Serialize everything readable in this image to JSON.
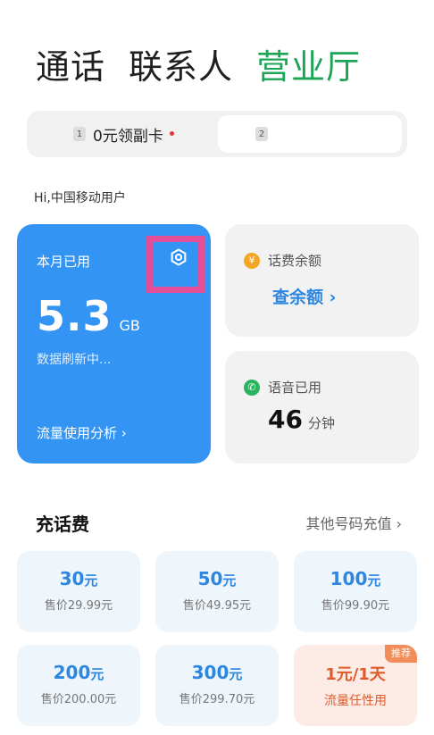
{
  "tabs": [
    "通话",
    "联系人",
    "营业厅"
  ],
  "sim": {
    "slot1_num": "1",
    "slot1_text": "0元领副卡",
    "slot2_num": "2"
  },
  "greeting": "Hi,中国移动用户",
  "data_card": {
    "label": "本月已用",
    "amount": "5.3",
    "unit": "GB",
    "status": "数据刷新中...",
    "analysis": "流量使用分析 ›"
  },
  "balance_card": {
    "icon_glyph": "¥",
    "title": "话费余额",
    "action": "查余额 ›"
  },
  "voice_card": {
    "icon_glyph": "✆",
    "title": "语音已用",
    "value": "46",
    "unit": "分钟"
  },
  "recharge": {
    "title": "充话费",
    "other_link": "其他号码充值 ›",
    "tiles": [
      {
        "amount": "30",
        "unit": "元",
        "price": "售价29.99元"
      },
      {
        "amount": "50",
        "unit": "元",
        "price": "售价49.95元"
      },
      {
        "amount": "100",
        "unit": "元",
        "price": "售价99.90元"
      },
      {
        "amount": "200",
        "unit": "元",
        "price": "售价200.00元"
      },
      {
        "amount": "300",
        "unit": "元",
        "price": "售价299.70元"
      },
      {
        "amount": "1元/1天",
        "unit": "",
        "price": "流量任性用",
        "tag": "推荐"
      }
    ]
  },
  "colors": {
    "accent_green": "#1ba554",
    "card_blue": "#3394f4",
    "link_blue": "#2d86e0",
    "highlight_pink": "#e44d97",
    "promo_orange": "#e05a2c"
  }
}
